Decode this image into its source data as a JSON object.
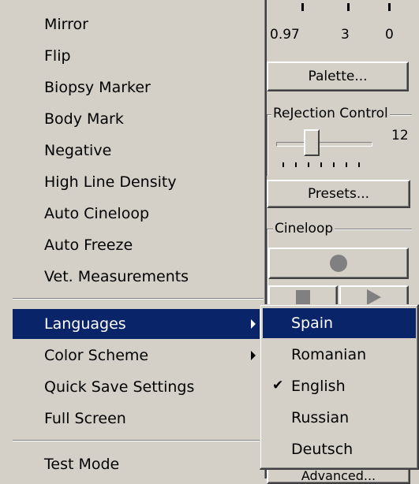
{
  "panel": {
    "values": [
      "0.97",
      "3",
      "0"
    ],
    "palette_button": "Palette...",
    "rejection_label": "ReJection Control",
    "rejection_value": "12",
    "rejection_level": 0.35,
    "presets_button": "Presets...",
    "cineloop_label": "Cineloop",
    "advanced_button": "Advanced..."
  },
  "menu": {
    "items": [
      {
        "label": "Mirror"
      },
      {
        "label": "Flip"
      },
      {
        "label": "Biopsy Marker"
      },
      {
        "label": "Body Mark"
      },
      {
        "label": "Negative"
      },
      {
        "label": "High Line Density"
      },
      {
        "label": "Auto Cineloop"
      },
      {
        "label": "Auto Freeze"
      },
      {
        "label": "Vet. Measurements"
      }
    ],
    "group2": [
      {
        "label": "Languages",
        "submenu": true,
        "selected": true
      },
      {
        "label": "Color Scheme",
        "submenu": true
      },
      {
        "label": "Quick Save Settings"
      },
      {
        "label": "Full Screen"
      }
    ],
    "test_mode": "Test Mode"
  },
  "languages_submenu": {
    "items": [
      {
        "label": "Spain",
        "selected": true
      },
      {
        "label": "Romanian"
      },
      {
        "label": "English",
        "checked": true
      },
      {
        "label": "Russian"
      },
      {
        "label": "Deutsch"
      }
    ],
    "check_glyph": "✔"
  },
  "colors": {
    "selection": "#0a246a",
    "face": "#d4d0c8"
  }
}
